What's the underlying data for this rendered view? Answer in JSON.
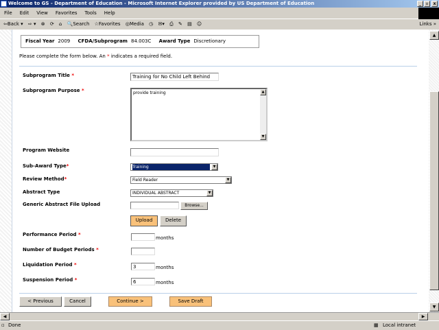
{
  "window": {
    "title": "Welcome to GS - Department of Education - Microsoft Internet Explorer provided by US Department of Education"
  },
  "menu": [
    "File",
    "Edit",
    "View",
    "Favorites",
    "Tools",
    "Help"
  ],
  "toolbar": {
    "back": "Back",
    "search": "Search",
    "favorites": "Favorites",
    "media": "Media",
    "links": "Links"
  },
  "header": {
    "fiscal_year_label": "Fiscal Year",
    "fiscal_year": "2009",
    "cfda_label": "CFDA/Subprogram",
    "cfda": "84.003C",
    "award_type_label": "Award Type",
    "award_type": "Discretionary"
  },
  "instructions": {
    "before": "Please complete the form below. An ",
    "star": "*",
    "after": " indicates a required field."
  },
  "form": {
    "subprogram_title": {
      "label": "Subprogram Title",
      "value": "Training for No Child Left Behind"
    },
    "subprogram_purpose": {
      "label": "Subprogram Purpose",
      "value": "provide training"
    },
    "program_website": {
      "label": "Program Website",
      "value": ""
    },
    "sub_award_type": {
      "label": "Sub-Award Type",
      "value": "Training"
    },
    "review_method": {
      "label": "Review Method",
      "value": "Field Reader"
    },
    "abstract_type": {
      "label": "Abstract Type",
      "value": "INDIVIDUAL ABSTRACT"
    },
    "abstract_upload": {
      "label": "Generic Abstract File Upload",
      "browse": "Browse...",
      "upload": "Upload",
      "delete": "Delete"
    },
    "performance_period": {
      "label": "Performance Period",
      "value": "",
      "unit": "months"
    },
    "budget_periods": {
      "label": "Number of Budget Periods",
      "value": ""
    },
    "liquidation_period": {
      "label": "Liquidation Period",
      "value": "3",
      "unit": "months"
    },
    "suspension_period": {
      "label": "Suspension Period",
      "value": "6",
      "unit": "months"
    },
    "required": "*"
  },
  "nav": {
    "previous": "< Previous",
    "cancel": "Cancel",
    "continue": "Continue >",
    "save_draft": "Save Draft"
  },
  "status": {
    "text": "Done",
    "zone": "Local intranet"
  },
  "colors": {
    "accent_button": "#f9c17a",
    "required": "#e00000",
    "selected": "#0a246a"
  }
}
